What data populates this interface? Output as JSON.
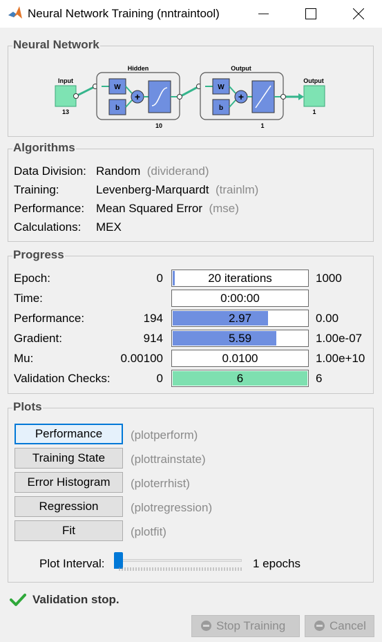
{
  "window": {
    "title": "Neural Network Training (nntraintool)"
  },
  "network": {
    "title": "Neural Network",
    "input_label": "Input",
    "input_size": "13",
    "hidden_label": "Hidden",
    "hidden_size": "10",
    "output_layer_label": "Output",
    "output_layer_size": "1",
    "output_label": "Output",
    "output_size": "1",
    "weight_symbol": "W",
    "bias_symbol": "b"
  },
  "algorithms": {
    "title": "Algorithms",
    "rows": [
      {
        "label": "Data Division:",
        "value": "Random",
        "func": "(dividerand)"
      },
      {
        "label": "Training:",
        "value": "Levenberg-Marquardt",
        "func": "(trainlm)"
      },
      {
        "label": "Performance:",
        "value": "Mean Squared Error",
        "func": "(mse)"
      },
      {
        "label": "Calculations:",
        "value": "MEX",
        "func": ""
      }
    ]
  },
  "progress": {
    "title": "Progress",
    "rows": [
      {
        "label": "Epoch:",
        "min": "0",
        "current": "20 iterations",
        "max": "1000",
        "fraction": 0.02,
        "fill": "#6f8fe0"
      },
      {
        "label": "Time:",
        "min": "",
        "current": "0:00:00",
        "max": "",
        "fraction": 0,
        "fill": "#6f8fe0"
      },
      {
        "label": "Performance:",
        "min": "194",
        "current": "2.97",
        "max": "0.00",
        "fraction": 0.71,
        "fill": "#6f8fe0"
      },
      {
        "label": "Gradient:",
        "min": "914",
        "current": "5.59",
        "max": "1.00e-07",
        "fraction": 0.77,
        "fill": "#6f8fe0"
      },
      {
        "label": "Mu:",
        "min": "0.00100",
        "current": "0.0100",
        "max": "1.00e+10",
        "fraction": 0,
        "fill": "#6f8fe0"
      },
      {
        "label": "Validation Checks:",
        "min": "0",
        "current": "6",
        "max": "6",
        "fraction": 1.0,
        "fill": "#7ee0b0"
      }
    ]
  },
  "plots": {
    "title": "Plots",
    "buttons": [
      {
        "label": "Performance",
        "func": "(plotperform)"
      },
      {
        "label": "Training State",
        "func": "(plottrainstate)"
      },
      {
        "label": "Error Histogram",
        "func": "(ploterrhist)"
      },
      {
        "label": "Regression",
        "func": "(plotregression)"
      },
      {
        "label": "Fit",
        "func": "(plotfit)"
      }
    ],
    "interval_label": "Plot Interval:",
    "interval_value": "1 epochs"
  },
  "status": {
    "text": "Validation stop."
  },
  "actions": {
    "stop_label": "Stop Training",
    "cancel_label": "Cancel"
  }
}
